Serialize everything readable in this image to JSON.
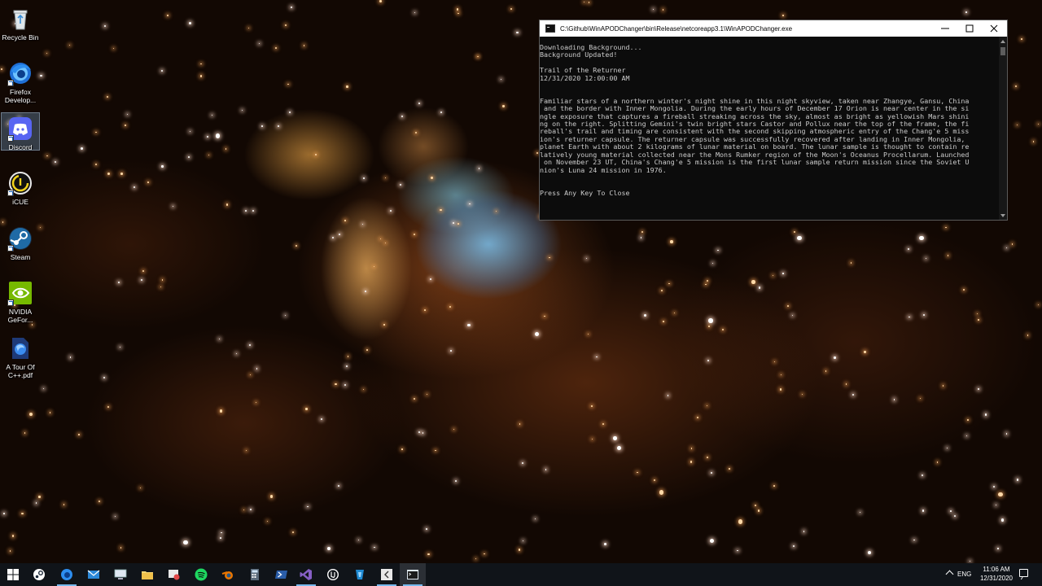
{
  "desktop": {
    "icons": [
      {
        "label": "Recycle Bin",
        "icon": "recycle-bin-icon"
      },
      {
        "label": "Firefox Develop...",
        "icon": "firefox-developer-icon"
      },
      {
        "label": "Discord",
        "icon": "discord-icon"
      },
      {
        "label": "iCUE",
        "icon": "icue-icon"
      },
      {
        "label": "Steam",
        "icon": "steam-icon"
      },
      {
        "label": "NVIDIA GeFor...",
        "icon": "nvidia-geforce-icon"
      },
      {
        "label": "A Tour Of C++.pdf",
        "icon": "pdf-document-icon"
      }
    ]
  },
  "console": {
    "title": "C:\\Github\\WinAPODChanger\\bin\\Release\\netcoreapp3.1\\WinAPODChanger.exe",
    "output": "Downloading Background...\nBackground Updated!\n\nTrail of the Returner\n12/31/2020 12:00:00 AM\n\n\nFamiliar stars of a northern winter's night shine in this night skyview, taken near Zhangye, Gansu, China\n and the border with Inner Mongolia. During the early hours of December 17 Orion is near center in the si\nngle exposure that captures a fireball streaking across the sky, almost as bright as yellowish Mars shini\nng on the right. Splitting Gemini's twin bright stars Castor and Pollux near the top of the frame, the fi\nreball's trail and timing are consistent with the second skipping atmospheric entry of the Chang'e 5 miss\nion's returner capsule. The returner capsule was successfully recovered after landing in Inner Mongolia,\nplanet Earth with about 2 kilograms of lunar material on board. The lunar sample is thought to contain re\nlatively young material collected near the Mons Rumker region of the Moon's Oceanus Procellarum. Launched\n on November 23 UT, China's Chang'e 5 mission is the first lunar sample return mission since the Soviet U\nnion's Luna 24 mission in 1976.\n\n\nPress Any Key To Close",
    "buttons": {
      "minimize": "—",
      "maximize": "☐",
      "close": "✕"
    }
  },
  "taskbar": {
    "items": [
      {
        "name": "start-button",
        "icon": "windows-logo-icon"
      },
      {
        "name": "steam",
        "icon": "steam-icon"
      },
      {
        "name": "firefox",
        "icon": "firefox-icon"
      },
      {
        "name": "mail",
        "icon": "mail-icon"
      },
      {
        "name": "remote-desktop",
        "icon": "remote-desktop-icon"
      },
      {
        "name": "file-explorer",
        "icon": "folder-icon"
      },
      {
        "name": "snipping-tool",
        "icon": "snipping-tool-icon"
      },
      {
        "name": "spotify",
        "icon": "spotify-icon"
      },
      {
        "name": "blender",
        "icon": "blender-icon"
      },
      {
        "name": "calculator",
        "icon": "calculator-icon"
      },
      {
        "name": "powershell",
        "icon": "powershell-icon"
      },
      {
        "name": "visual-studio",
        "icon": "visual-studio-icon"
      },
      {
        "name": "unreal-engine",
        "icon": "unreal-engine-icon"
      },
      {
        "name": "app-blue",
        "icon": "app-icon"
      },
      {
        "name": "visual-studio-code",
        "icon": "vscode-icon"
      },
      {
        "name": "console-window",
        "icon": "console-icon"
      }
    ],
    "tray": {
      "language": "ENG",
      "time": "11:06 AM",
      "date": "12/31/2020"
    }
  },
  "colors": {
    "console_bg": "#0c0c0c",
    "console_text": "#cccccc",
    "taskbar_bg": "#101419",
    "taskbar_accent": "#76b9ed"
  }
}
